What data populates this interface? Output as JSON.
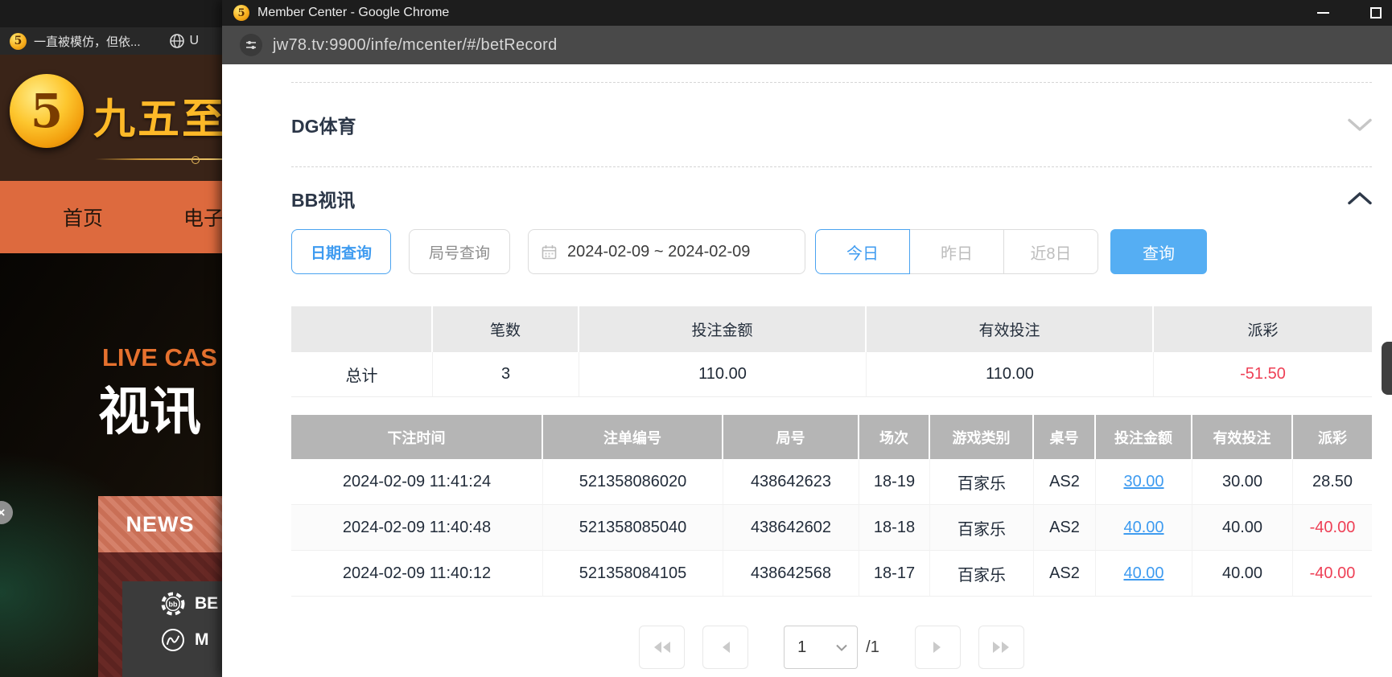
{
  "background": {
    "tab_strip": {
      "tab1_title": "一直被模仿，但依...",
      "tab2_title": "U"
    },
    "brand": {
      "logo_glyph": "5",
      "name": "九五至尊"
    },
    "nav": {
      "items": [
        "首页",
        "电子"
      ]
    },
    "banner": {
      "line1": "LIVE CAS",
      "line2": "视讯"
    },
    "news": {
      "label": "NEWS"
    },
    "game_menu": {
      "items": [
        {
          "icon": "bb-chip-icon",
          "label": "BE"
        },
        {
          "icon": "mg-circle-icon",
          "label": "M"
        }
      ]
    },
    "close_glyph": "×"
  },
  "window": {
    "logo_glyph": "5",
    "title": "Member Center - Google Chrome",
    "url": "jw78.tv:9900/infe/mcenter/#/betRecord"
  },
  "sections": {
    "dg": "DG体育",
    "bb": "BB视讯"
  },
  "filters": {
    "date_query": "日期查询",
    "round_query": "局号查询",
    "date_range": "2024-02-09 ~ 2024-02-09",
    "today": "今日",
    "yesterday": "昨日",
    "last8": "近8日",
    "search": "查询"
  },
  "summary_table": {
    "headers": {
      "blank": "",
      "count": "笔数",
      "bet_amount": "投注金额",
      "valid_bet": "有效投注",
      "payout": "派彩"
    },
    "total_label": "总计",
    "total": {
      "count": "3",
      "bet_amount": "110.00",
      "valid_bet": "110.00",
      "payout": "-51.50"
    }
  },
  "detail_table": {
    "headers": [
      "下注时间",
      "注单编号",
      "局号",
      "场次",
      "游戏类别",
      "桌号",
      "投注金额",
      "有效投注",
      "派彩"
    ],
    "rows": [
      [
        "2024-02-09 11:41:24",
        "521358086020",
        "438642623",
        "18-19",
        "百家乐",
        "AS2",
        "30.00",
        "30.00",
        "28.50"
      ],
      [
        "2024-02-09 11:40:48",
        "521358085040",
        "438642602",
        "18-18",
        "百家乐",
        "AS2",
        "40.00",
        "40.00",
        "-40.00"
      ],
      [
        "2024-02-09 11:40:12",
        "521358084105",
        "438642568",
        "18-17",
        "百家乐",
        "AS2",
        "40.00",
        "40.00",
        "-40.00"
      ]
    ]
  },
  "pagination": {
    "page": "1",
    "total": "/1"
  },
  "colors": {
    "accent_blue": "#3e9bf0",
    "primary_button_blue": "#55aef3",
    "negative_red": "#ee4056",
    "detail_header_gray": "#b5b5b5",
    "summary_header_gray": "#e9e9e9",
    "nav_orange": "#dd6a3e",
    "brand_gold": "#fdb928"
  }
}
